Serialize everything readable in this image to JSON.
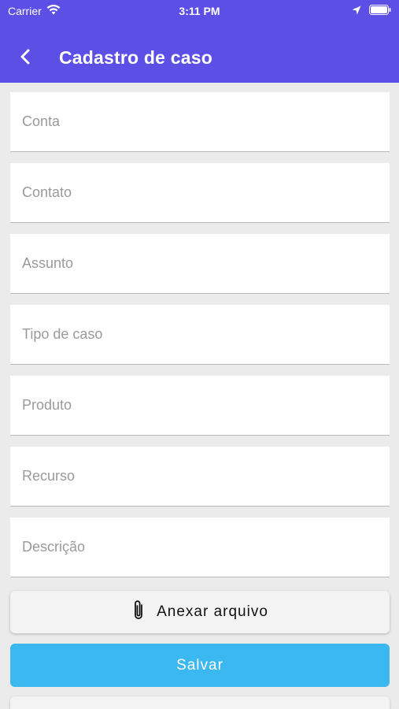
{
  "status_bar": {
    "carrier": "Carrier",
    "time": "3:11 PM"
  },
  "header": {
    "title": "Cadastro de caso",
    "back_icon": "chevron-left-icon",
    "background_color": "#5b4fe6"
  },
  "form": {
    "fields": [
      {
        "placeholder": "Conta",
        "value": ""
      },
      {
        "placeholder": "Contato",
        "value": ""
      },
      {
        "placeholder": "Assunto",
        "value": ""
      },
      {
        "placeholder": "Tipo de caso",
        "value": ""
      },
      {
        "placeholder": "Produto",
        "value": ""
      },
      {
        "placeholder": "Recurso",
        "value": ""
      },
      {
        "placeholder": "Descrição",
        "value": ""
      }
    ]
  },
  "actions": {
    "attach_label": "Anexar arquivo",
    "attach_icon": "paperclip-icon",
    "save_label": "Salvar",
    "save_color": "#3bb8ef"
  }
}
